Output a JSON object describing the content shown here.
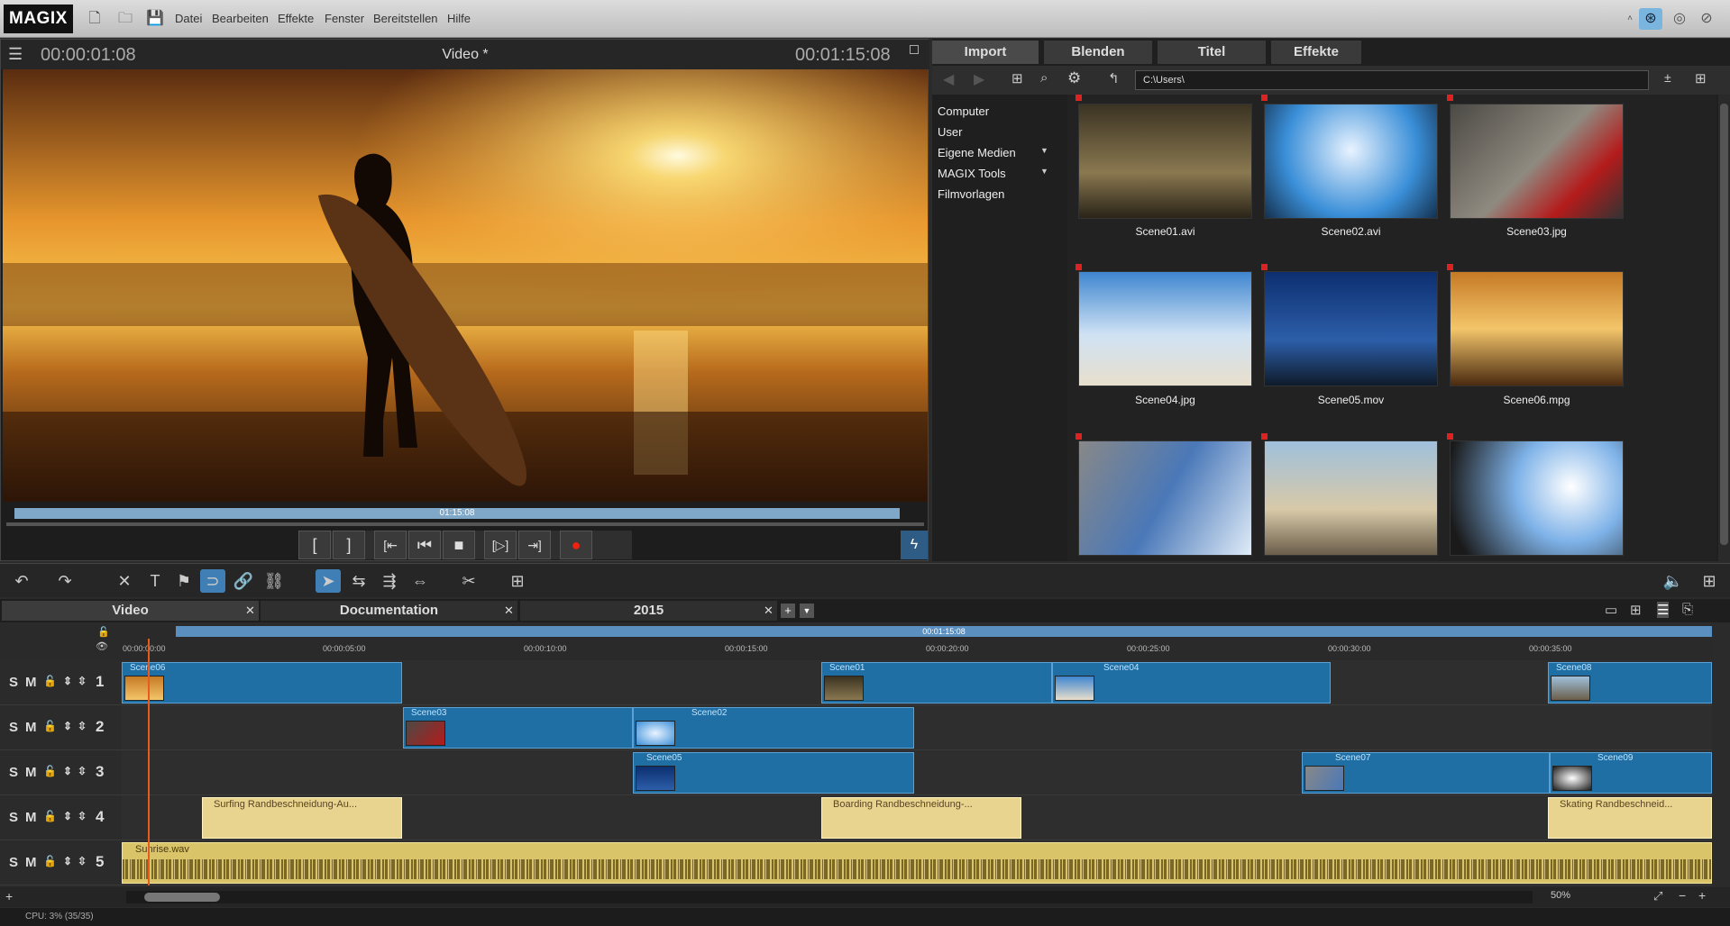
{
  "app": {
    "logo": "MAGIX"
  },
  "menu": [
    "Datei",
    "Bearbeiten",
    "Effekte",
    "Fenster",
    "Bereitstellen",
    "Hilfe"
  ],
  "preview": {
    "timecode_left": "00:00:01:08",
    "title": "Video *",
    "timecode_right": "00:01:15:08",
    "scrub_label": "01:15:08",
    "transport": [
      "[",
      "]",
      "[⇤",
      "⏮",
      "■",
      "[▷]",
      "⇥]",
      "●"
    ]
  },
  "media_panel": {
    "tabs": [
      "Import",
      "Blenden",
      "Titel",
      "Effekte"
    ],
    "path": "C:\\Users\\",
    "tree": [
      "Computer",
      "User",
      "Eigene Medien",
      "MAGIX Tools",
      "Filmvorlagen"
    ],
    "files": [
      "Scene01.avi",
      "Scene02.avi",
      "Scene03.jpg",
      "Scene04.jpg",
      "Scene05.mov",
      "Scene06.mpg",
      "",
      "",
      ""
    ]
  },
  "timeline": {
    "tabs": [
      "Video",
      "Documentation",
      "2015"
    ],
    "range_label": "00:01:15:08",
    "ruler": [
      "00:00:00:00",
      "00:00:05:00",
      "00:00:10:00",
      "00:00:15:00",
      "00:00:20:00",
      "00:00:25:00",
      "00:00:30:00",
      "00:00:35:00"
    ],
    "track_numbers": [
      "1",
      "2",
      "3",
      "4",
      "5"
    ],
    "track_controls": [
      "S",
      "M"
    ],
    "clips": {
      "t1": [
        "Scene06",
        "Scene01",
        "Scene04",
        "Scene08"
      ],
      "t2": [
        "Scene03",
        "Scene02"
      ],
      "t3": [
        "Scene05",
        "Scene07",
        "Scene09"
      ],
      "t4": [
        "Surfing   Randbeschneidung-Au...",
        "Boarding   Randbeschneidung-...",
        "Skating   Randbeschneid..."
      ],
      "t5": [
        "Sunrise.wav"
      ]
    },
    "zoom": "50%"
  },
  "status": {
    "cpu": "CPU: 3% (35/35)"
  }
}
